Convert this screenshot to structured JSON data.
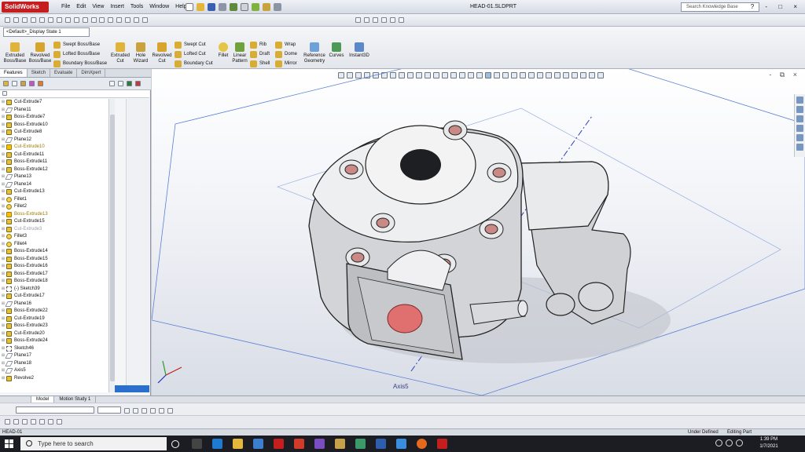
{
  "app": {
    "name": "SolidWorks",
    "document_title": "HEAD-01.SLDPRT",
    "menus": [
      "File",
      "Edit",
      "View",
      "Insert",
      "Tools",
      "Window",
      "Help"
    ],
    "search_placeholder": "Search Knowledge Base",
    "window_controls": "? - □ ×"
  },
  "configuration": "<Default>_Display State 1",
  "command_manager": {
    "large": [
      {
        "label": "Extruded Boss/Base",
        "icon": "extruded-boss-icon"
      },
      {
        "label": "Revolved Boss/Base",
        "icon": "revolved-boss-icon"
      },
      {
        "label": "Extruded Cut",
        "icon": "extruded-cut-icon"
      },
      {
        "label": "Hole Wizard",
        "icon": "hole-wizard-icon"
      },
      {
        "label": "Revolved Cut",
        "icon": "revolved-cut-icon"
      },
      {
        "label": "Fillet",
        "icon": "fillet-icon"
      },
      {
        "label": "Linear Pattern",
        "icon": "linear-pattern-icon"
      },
      {
        "label": "Reference Geometry",
        "icon": "reference-geometry-icon"
      },
      {
        "label": "Curves",
        "icon": "curves-icon"
      },
      {
        "label": "Instant3D",
        "icon": "instant3d-icon"
      }
    ],
    "small_col1": [
      "Swept Boss/Base",
      "Lofted Boss/Base",
      "Boundary Boss/Base"
    ],
    "small_col2": [
      "Swept Cut",
      "Lofted Cut",
      "Boundary Cut"
    ],
    "small_col3": [
      "Rib",
      "Draft",
      "Shell"
    ],
    "small_col4": [
      "Wrap",
      "Dome",
      "Mirror"
    ]
  },
  "panel_tabs": [
    "Features",
    "Sketch",
    "Evaluate",
    "DimXpert"
  ],
  "feature_tree": [
    {
      "label": "Cut-Extrude7",
      "type": "extrude"
    },
    {
      "label": "Plane11",
      "type": "plane"
    },
    {
      "label": "Boss-Extrude7",
      "type": "extrude"
    },
    {
      "label": "Boss-Extrude10",
      "type": "extrude"
    },
    {
      "label": "Cut-Extrude8",
      "type": "extrude"
    },
    {
      "label": "Plane12",
      "type": "plane"
    },
    {
      "label": "Cut-Extrude10",
      "type": "warn"
    },
    {
      "label": "Cut-Extrude11",
      "type": "extrude"
    },
    {
      "label": "Boss-Extrude11",
      "type": "extrude"
    },
    {
      "label": "Boss-Extrude12",
      "type": "extrude"
    },
    {
      "label": "Plane13",
      "type": "plane"
    },
    {
      "label": "Plane14",
      "type": "plane"
    },
    {
      "label": "Cut-Extrude13",
      "type": "extrude"
    },
    {
      "label": "Fillet1",
      "type": "fillet"
    },
    {
      "label": "Fillet2",
      "type": "fillet"
    },
    {
      "label": "Boss-Extrude13",
      "type": "warn"
    },
    {
      "label": "Cut-Extrude15",
      "type": "extrude"
    },
    {
      "label": "Cut-Extrude3",
      "type": "grey"
    },
    {
      "label": "Fillet3",
      "type": "fillet"
    },
    {
      "label": "Fillet4",
      "type": "fillet"
    },
    {
      "label": "Boss-Extrude14",
      "type": "extrude"
    },
    {
      "label": "Boss-Extrude15",
      "type": "extrude"
    },
    {
      "label": "Boss-Extrude16",
      "type": "extrude"
    },
    {
      "label": "Boss-Extrude17",
      "type": "extrude"
    },
    {
      "label": "Boss-Extrude18",
      "type": "extrude"
    },
    {
      "label": "(-) Sketch39",
      "type": "sketch"
    },
    {
      "label": "Cut-Extrude17",
      "type": "extrude"
    },
    {
      "label": "Plane16",
      "type": "plane"
    },
    {
      "label": "Boss-Extrude22",
      "type": "extrude"
    },
    {
      "label": "Cut-Extrude19",
      "type": "extrude"
    },
    {
      "label": "Boss-Extrude23",
      "type": "extrude"
    },
    {
      "label": "Cut-Extrude20",
      "type": "extrude"
    },
    {
      "label": "Boss-Extrude24",
      "type": "extrude"
    },
    {
      "label": "Sketch46",
      "type": "sketch"
    },
    {
      "label": "Plane17",
      "type": "plane"
    },
    {
      "label": "Plane18",
      "type": "plane"
    },
    {
      "label": "Axis5",
      "type": "plane"
    },
    {
      "label": "Revolve2",
      "type": "extrude"
    }
  ],
  "viewport": {
    "axis_label": "Axis5",
    "window_controls": "- ⧉ ×"
  },
  "bottom_tabs": [
    "Model",
    "Motion Study 1"
  ],
  "status": {
    "left": "HEAD-01",
    "mid": "Under Defined",
    "right": "Editing Part"
  },
  "taskbar": {
    "search_placeholder": "Type here to search",
    "time": "1:39 PM",
    "date": "1/7/2021"
  },
  "colors": {
    "accent": "#2a6fd0",
    "logo": "#c41e1e",
    "part": "#dcdcdc",
    "cut_face": "#e07070"
  }
}
